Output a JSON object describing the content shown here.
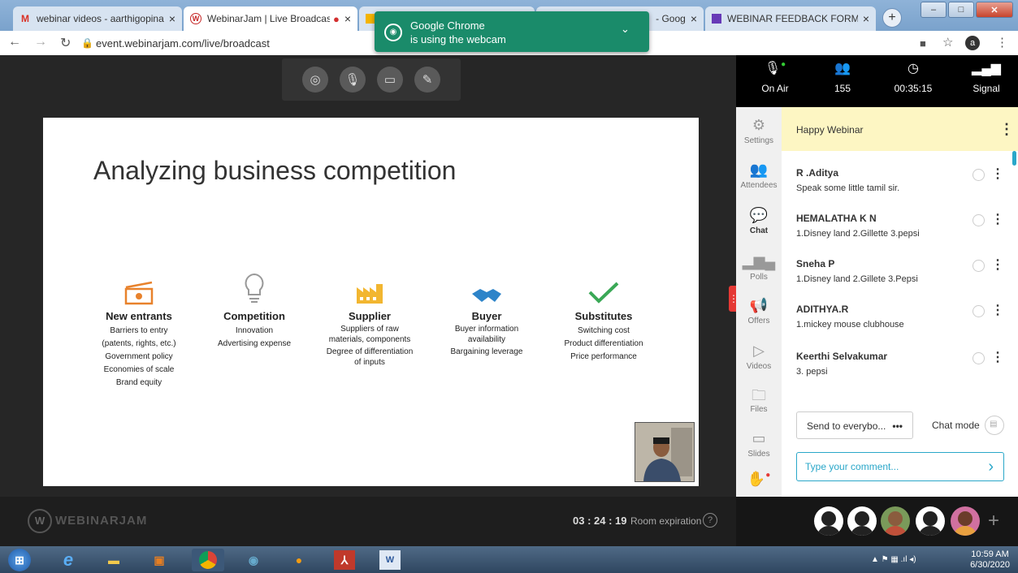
{
  "browser": {
    "tabs": [
      {
        "label": "webinar videos - aarthigopinath",
        "favicon": "gmail-icon",
        "color": "#d93025"
      },
      {
        "label": "WebinarJam | Live Broadcas",
        "favicon": "webinarjam-icon",
        "color": "#c62828"
      },
      {
        "label": "",
        "favicon": "slides-icon",
        "color": "#f4b400"
      },
      {
        "label": "- Goog",
        "favicon": "forms-icon",
        "color": "#673ab7"
      },
      {
        "label": "WEBINAR FEEDBACK FORM",
        "favicon": "forms-icon",
        "color": "#673ab7"
      }
    ],
    "url": "event.webinarjam.com/live/broadcast",
    "profile_initial": "a",
    "notification": {
      "title": "Google Chrome",
      "text": "is using the webcam"
    }
  },
  "slide": {
    "title": "Analyzing business competition",
    "columns": [
      {
        "heading": "New entrants",
        "lines": [
          "Barriers to entry",
          "(patents, rights, etc.)",
          "Government policy",
          "Economies of scale",
          "Brand equity"
        ],
        "icon": "money-icon",
        "color": "#e8822c"
      },
      {
        "heading": "Competition",
        "lines": [
          "Innovation",
          "Advertising expense"
        ],
        "icon": "lightbulb-icon",
        "color": "#999999"
      },
      {
        "heading": "Supplier",
        "lines": [
          "Suppliers of raw",
          "materials, components",
          "Degree of differentiation",
          "of inputs"
        ],
        "icon": "factory-icon",
        "color": "#f2b630"
      },
      {
        "heading": "Buyer",
        "lines": [
          "Buyer information",
          "availability",
          "Bargaining leverage"
        ],
        "icon": "handshake-icon",
        "color": "#2d84c9"
      },
      {
        "heading": "Substitutes",
        "lines": [
          "Switching cost",
          "Product differentiation",
          "Price performance"
        ],
        "icon": "checkmark-icon",
        "color": "#3aa856"
      }
    ]
  },
  "footer": {
    "brand": "WEBINARJAM",
    "timer": "03 : 24 : 19",
    "expiration_label": "Room expiration"
  },
  "stats": {
    "onair": "On Air",
    "attendees": "155",
    "time": "00:35:15",
    "signal": "Signal"
  },
  "sidebar": [
    "Settings",
    "Attendees",
    "Chat",
    "Polls",
    "Offers",
    "Videos",
    "Files",
    "Slides"
  ],
  "chat": {
    "banner": "Happy Webinar",
    "messages": [
      {
        "name": "R .Aditya",
        "text": "Speak some little tamil sir."
      },
      {
        "name": "HEMALATHA K N",
        "text": "1.Disney land 2.Gillette 3.pepsi"
      },
      {
        "name": "Sneha P",
        "text": "1.Disney land 2.Gillete 3.Pepsi"
      },
      {
        "name": "ADITHYA.R",
        "text": "1.mickey mouse clubhouse"
      },
      {
        "name": "Keerthi Selvakumar",
        "text": "3. pepsi"
      }
    ],
    "send_to": "Send to everybo...",
    "send_more": "•••",
    "mode_label": "Chat mode",
    "placeholder": "Type your comment..."
  },
  "taskbar": {
    "time": "10:59 AM",
    "date": "6/30/2020"
  }
}
